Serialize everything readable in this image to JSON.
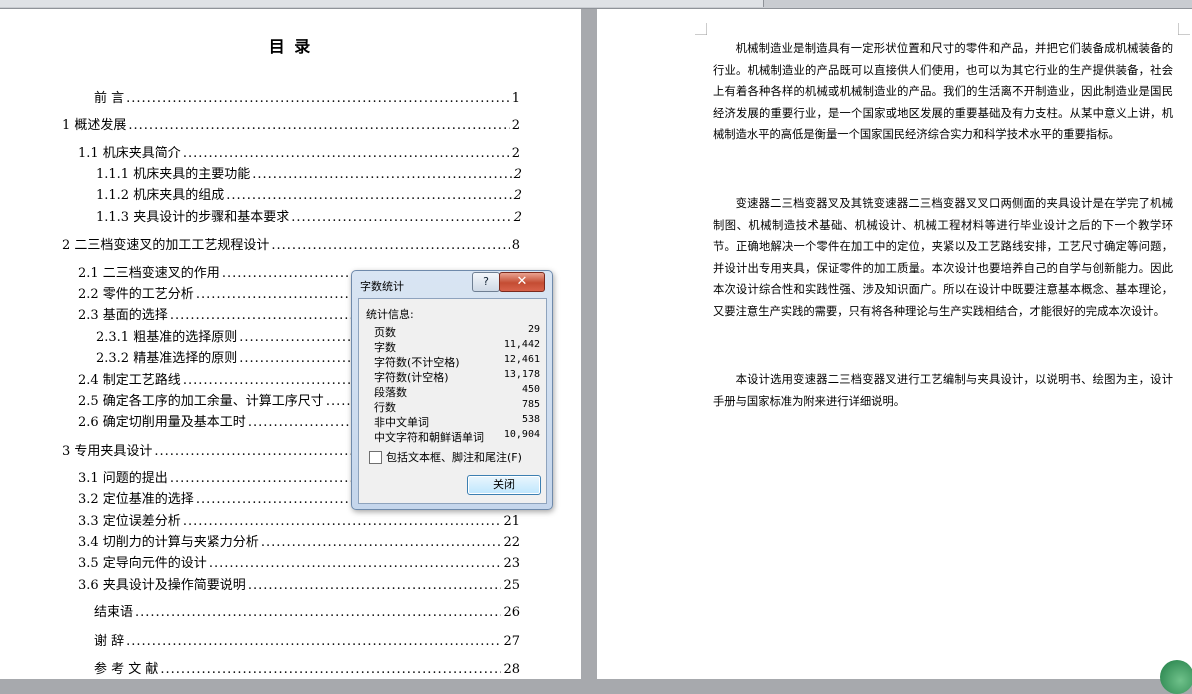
{
  "toc": {
    "title": "目  录",
    "entries": [
      {
        "text": "前 言",
        "page": "1"
      },
      {
        "text": "1 概述发展",
        "page": "2"
      },
      {
        "text": "1.1 机床夹具简介",
        "page": "2"
      },
      {
        "text": "1.1.1 机床夹具的主要功能",
        "page": "2"
      },
      {
        "text": "1.1.2 机床夹具的组成",
        "page": "2"
      },
      {
        "text": "1.1.3 夹具设计的步骤和基本要求",
        "page": "2"
      },
      {
        "text": "2 二三档变速叉的加工工艺规程设计",
        "page": "8"
      },
      {
        "text": "2.1 二三档变速叉的作用",
        "page": ""
      },
      {
        "text": "2.2 零件的工艺分析",
        "page": ""
      },
      {
        "text": "2.3 基面的选择",
        "page": ""
      },
      {
        "text": "2.3.1 粗基准的选择原则",
        "page": ""
      },
      {
        "text": "2.3.2 精基准选择的原则",
        "page": ""
      },
      {
        "text": "2.4 制定工艺路线",
        "page": ""
      },
      {
        "text": "2.5 确定各工序的加工余量、计算工序尺寸",
        "page": ""
      },
      {
        "text": "2.6 确定切削用量及基本工时",
        "page": ""
      },
      {
        "text": "3 专用夹具设计",
        "page": ""
      },
      {
        "text": "3.1 问题的提出",
        "page": ""
      },
      {
        "text": "3.2 定位基准的选择",
        "page": ""
      },
      {
        "text": "3.3 定位误差分析",
        "page": "21"
      },
      {
        "text": "3.4 切削力的计算与夹紧力分析",
        "page": "22"
      },
      {
        "text": "3.5 定导向元件的设计",
        "page": "23"
      },
      {
        "text": "3.6 夹具设计及操作简要说明",
        "page": "25"
      },
      {
        "text": "结束语",
        "page": "26"
      },
      {
        "text": "谢 辞",
        "page": "27"
      },
      {
        "text": "参 考 文 献",
        "page": "28"
      }
    ]
  },
  "body": {
    "paragraphs": [
      "机械制造业是制造具有一定形状位置和尺寸的零件和产品，并把它们装备成机械装备的行业。机械制造业的产品既可以直接供人们使用，也可以为其它行业的生产提供装备，社会上有着各种各样的机械或机械制造业的产品。我们的生活离不开制造业，因此制造业是国民经济发展的重要行业，是一个国家或地区发展的重要基础及有力支柱。从某中意义上讲，机械制造水平的高低是衡量一个国家国民经济综合实力和科学技术水平的重要指标。",
      "变速器二三档变器叉及其铣变速器二三档变器叉叉口两侧面的夹具设计是在学完了机械制图、机械制造技术基础、机械设计、机械工程材料等进行毕业设计之后的下一个教学环节。正确地解决一个零件在加工中的定位，夹紧以及工艺路线安排，工艺尺寸确定等问题，并设计出专用夹具，保证零件的加工质量。本次设计也要培养自己的自学与创新能力。因此本次设计综合性和实践性强、涉及知识面广。所以在设计中既要注意基本概念、基本理论，又要注意生产实践的需要，只有将各种理论与生产实践相结合，才能很好的完成本次设计。",
      "本设计选用变速器二三档变器叉进行工艺编制与夹具设计，以说明书、绘图为主，设计手册与国家标准为附来进行详细说明。"
    ]
  },
  "dialog": {
    "title": "字数统计",
    "help_label": "?",
    "close_x": "✕",
    "group_label": "统计信息:",
    "stats": [
      {
        "label": "页数",
        "value": "29"
      },
      {
        "label": "字数",
        "value": "11,442"
      },
      {
        "label": "字符数(不计空格)",
        "value": "12,461"
      },
      {
        "label": "字符数(计空格)",
        "value": "13,178"
      },
      {
        "label": "段落数",
        "value": "450"
      },
      {
        "label": "行数",
        "value": "785"
      },
      {
        "label": "非中文单词",
        "value": "538"
      },
      {
        "label": "中文字符和朝鲜语单词",
        "value": "10,904"
      }
    ],
    "checkbox_label": "包括文本框、脚注和尾注(F)",
    "close_button": "关闭"
  }
}
